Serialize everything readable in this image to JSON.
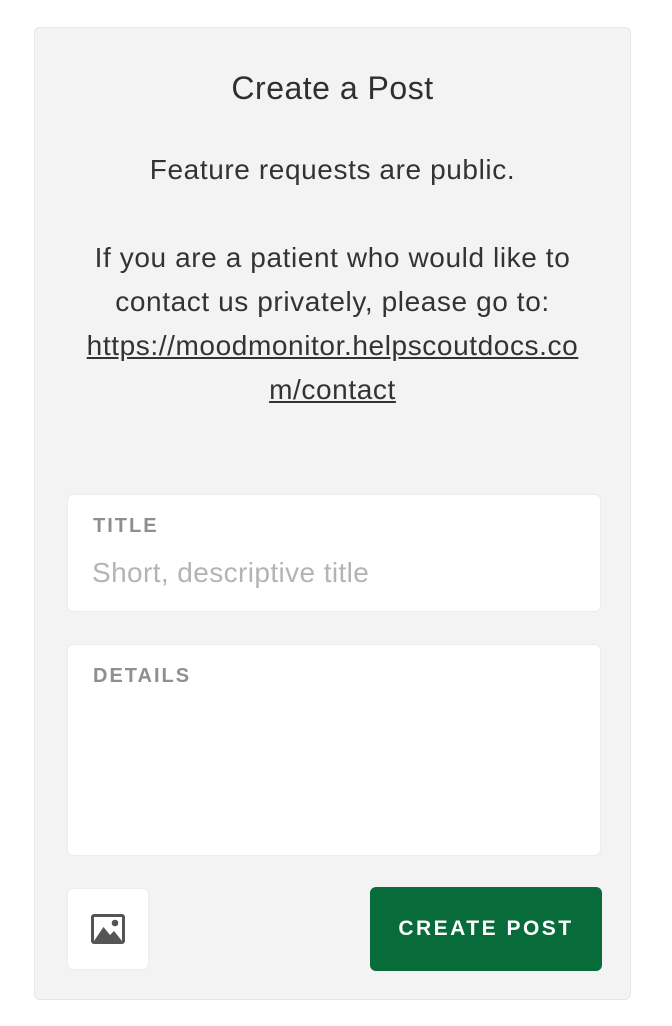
{
  "form": {
    "heading": "Create a Post",
    "description": {
      "line1": "Feature requests are public.",
      "line2": "If you are a patient who would like to contact us privately, please go to:",
      "link": "https://moodmonitor.helpscoutdocs.com/contact"
    },
    "title_field": {
      "label": "TITLE",
      "placeholder": "Short, descriptive title",
      "value": ""
    },
    "details_field": {
      "label": "DETAILS",
      "value": ""
    },
    "image_button_icon": "image-icon",
    "submit_label": "CREATE POST"
  },
  "colors": {
    "card_background": "#f3f3f3",
    "submit_background": "#076b3a",
    "label_gray": "#8f8f8f"
  }
}
